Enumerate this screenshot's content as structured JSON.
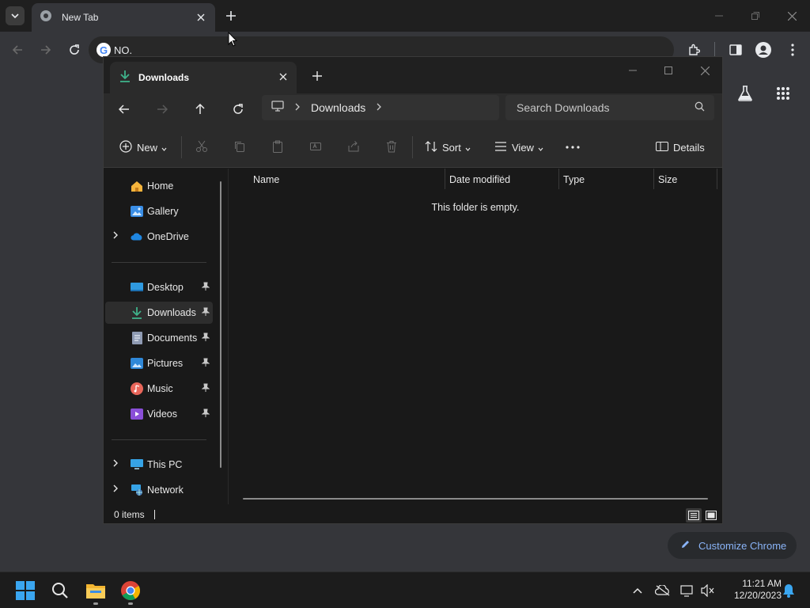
{
  "chrome": {
    "tab_title": "New Tab",
    "omnibox_text": "NO.",
    "customize_label": "Customize Chrome"
  },
  "explorer": {
    "tab_title": "Downloads",
    "breadcrumb": "Downloads",
    "search_placeholder": "Search Downloads",
    "commands": {
      "new": "New",
      "sort": "Sort",
      "view": "View",
      "details": "Details"
    },
    "sidebar": {
      "items": [
        {
          "label": "Home",
          "icon": "home-icon"
        },
        {
          "label": "Gallery",
          "icon": "gallery-icon"
        },
        {
          "label": "OneDrive",
          "icon": "onedrive-icon"
        },
        {
          "label": "Desktop",
          "icon": "desktop-icon"
        },
        {
          "label": "Downloads",
          "icon": "downloads-icon"
        },
        {
          "label": "Documents",
          "icon": "documents-icon"
        },
        {
          "label": "Pictures",
          "icon": "pictures-icon"
        },
        {
          "label": "Music",
          "icon": "music-icon"
        },
        {
          "label": "Videos",
          "icon": "videos-icon"
        },
        {
          "label": "This PC",
          "icon": "this-pc-icon"
        },
        {
          "label": "Network",
          "icon": "network-icon"
        }
      ]
    },
    "columns": [
      "Name",
      "Date modified",
      "Type",
      "Size"
    ],
    "empty_message": "This folder is empty.",
    "status": "0 items"
  },
  "taskbar": {
    "time": "11:21 AM",
    "date": "12/20/2023"
  },
  "colors": {
    "accent": "#8ab4f8",
    "explorer_bg": "#191919",
    "chrome_bg": "#35363a"
  }
}
